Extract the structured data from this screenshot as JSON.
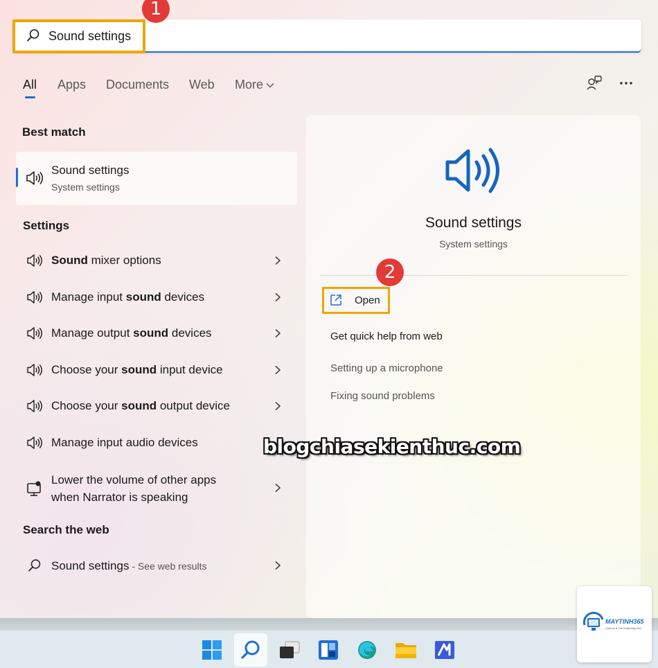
{
  "search": {
    "query": "Sound settings"
  },
  "badges": {
    "step1": "1",
    "step2": "2"
  },
  "tabs": [
    {
      "label": "All"
    },
    {
      "label": "Apps"
    },
    {
      "label": "Documents"
    },
    {
      "label": "Web"
    },
    {
      "label": "More"
    }
  ],
  "toolbar": {
    "icons": [
      "feedback-icon",
      "more-options-icon"
    ]
  },
  "best_match": {
    "heading": "Best match",
    "title": "Sound settings",
    "subtitle": "System settings"
  },
  "settings": {
    "heading": "Settings",
    "items": [
      {
        "pre": "",
        "bold": "Sound",
        "post": " mixer options",
        "icon": "speaker-icon"
      },
      {
        "pre": "Manage input ",
        "bold": "sound",
        "post": " devices",
        "icon": "speaker-icon"
      },
      {
        "pre": "Manage output ",
        "bold": "sound",
        "post": " devices",
        "icon": "speaker-icon"
      },
      {
        "pre": "Choose your ",
        "bold": "sound",
        "post": " input device",
        "icon": "speaker-icon"
      },
      {
        "pre": "Choose your ",
        "bold": "sound",
        "post": " output device",
        "icon": "speaker-icon"
      },
      {
        "pre": "Manage input audio devices",
        "bold": "",
        "post": "",
        "icon": "speaker-icon"
      },
      {
        "line1": "Lower the volume of other apps",
        "line2": "when Narrator is speaking",
        "icon": "narrator-icon"
      }
    ]
  },
  "web": {
    "heading": "Search the web",
    "query": "Sound settings",
    "suffix": " - See web results"
  },
  "preview": {
    "title": "Sound settings",
    "subtitle": "System settings",
    "open_label": "Open",
    "help_heading": "Get quick help from web",
    "help_links": [
      "Setting up a microphone",
      "Fixing sound problems"
    ]
  },
  "watermark": "blogchiasekienthuc.com",
  "corner_logo": {
    "name": "MAYTINH365",
    "tagline": "Chia sẻ & Thủ thuật Máy tính"
  },
  "taskbar": {
    "items": [
      "windows-start-icon",
      "search-icon",
      "task-view-icon",
      "widgets-icon",
      "edge-icon",
      "file-explorer-icon",
      "store-icon"
    ]
  },
  "colors": {
    "accent": "#1f6ed2",
    "highlight": "#f0a500",
    "badge": "#e23a36"
  }
}
